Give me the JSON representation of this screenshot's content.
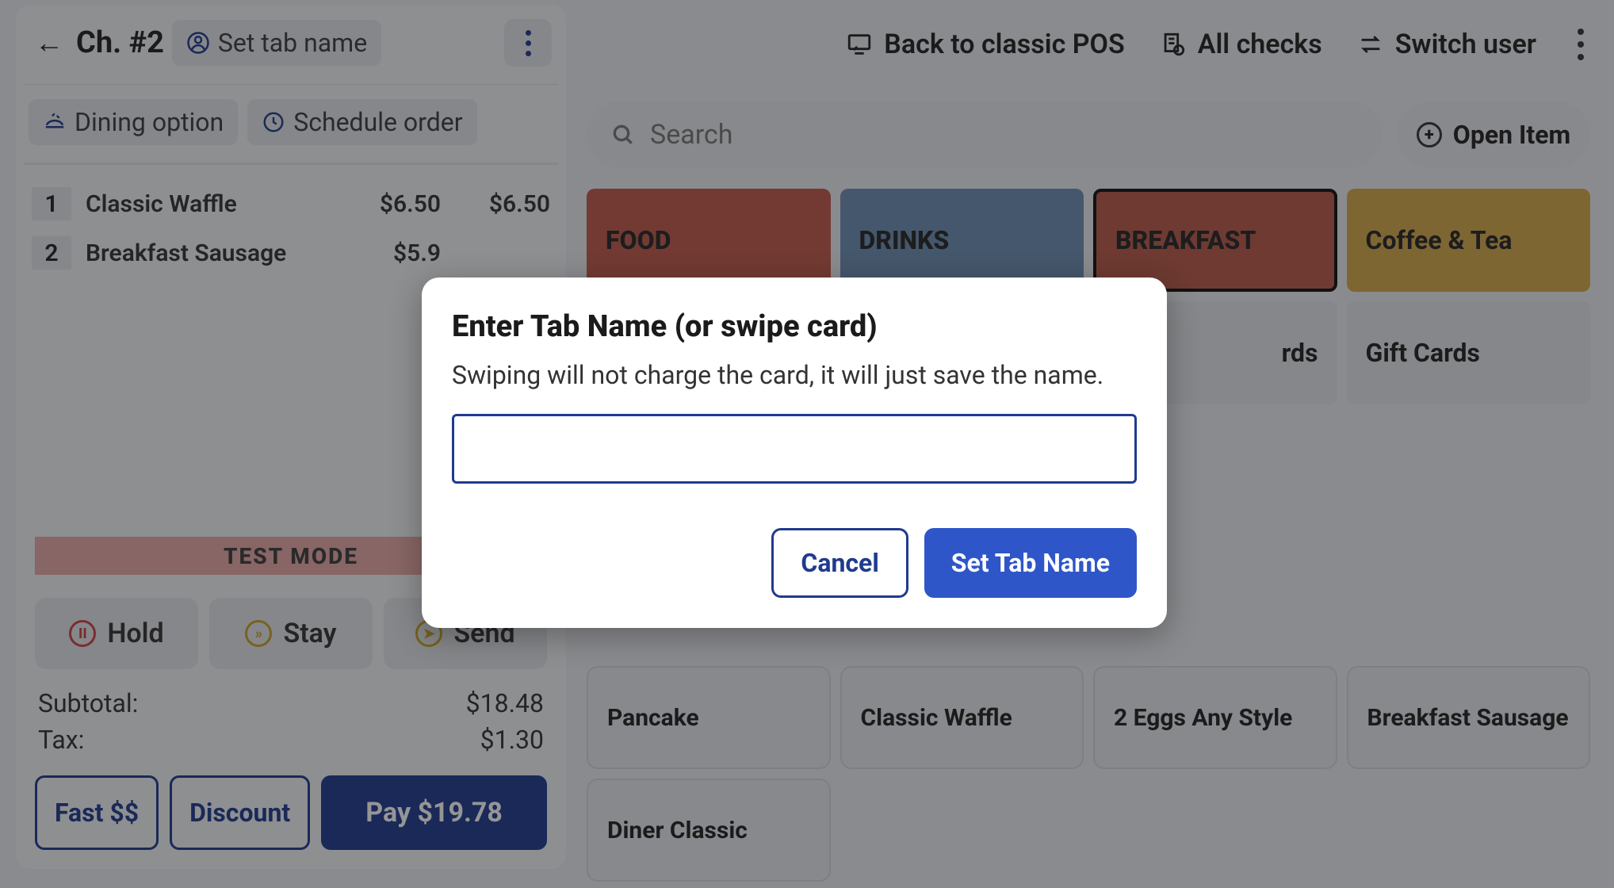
{
  "header": {
    "check_label": "Ch. #2",
    "tab_name_label": "Set tab name"
  },
  "options": {
    "dining_label": "Dining option",
    "schedule_label": "Schedule order"
  },
  "order": {
    "items": [
      {
        "qty": "1",
        "name": "Classic Waffle",
        "price": "$6.50",
        "total": "$6.50"
      },
      {
        "qty": "2",
        "name": "Breakfast Sausage",
        "price": "$5.9",
        "total": ""
      }
    ],
    "test_mode": "TEST MODE",
    "hold": "Hold",
    "stay": "Stay",
    "send": "Send",
    "subtotal_label": "Subtotal:",
    "subtotal_value": "$18.48",
    "tax_label": "Tax:",
    "tax_value": "$1.30",
    "fast_label": "Fast $$",
    "discount_label": "Discount",
    "pay_label": "Pay $19.78"
  },
  "topbar": {
    "back_classic": "Back to classic POS",
    "all_checks": "All checks",
    "switch_user": "Switch user"
  },
  "search": {
    "placeholder": "Search"
  },
  "open_item": "Open Item",
  "categories": {
    "food": "FOOD",
    "drinks": "DRINKS",
    "breakfast": "BREAKFAST",
    "coffee": "Coffee & Tea",
    "rds": "rds",
    "gift": "Gift Cards"
  },
  "items": {
    "pancake": "Pancake",
    "waffle": "Classic Waffle",
    "eggs": "2 Eggs Any Style",
    "sausage": "Breakfast Sausage",
    "diner": "Diner Classic"
  },
  "modal": {
    "title": "Enter Tab Name (or swipe card)",
    "subtitle": "Swiping will not charge the card, it will just save the name.",
    "input_value": "",
    "cancel": "Cancel",
    "confirm": "Set Tab Name"
  }
}
